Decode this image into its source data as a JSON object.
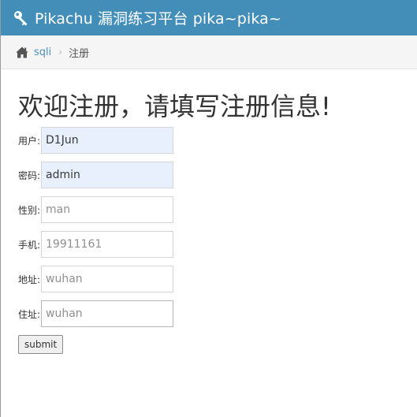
{
  "header": {
    "title": "Pikachu 漏洞练习平台 pika~pika~",
    "icon": "key-icon"
  },
  "breadcrumb": {
    "home_icon": "home-icon",
    "link": "sqli",
    "separator": "›",
    "current": "注册"
  },
  "page": {
    "heading": "欢迎注册，请填写注册信息!"
  },
  "form": {
    "fields": [
      {
        "label": "用户:",
        "value": "D1Jun",
        "placeholder": ""
      },
      {
        "label": "密码:",
        "value": "admin",
        "placeholder": ""
      },
      {
        "label": "性别:",
        "value": "",
        "placeholder": "man"
      },
      {
        "label": "手机:",
        "value": "",
        "placeholder": "19911161"
      },
      {
        "label": "地址:",
        "value": "",
        "placeholder": "wuhan"
      },
      {
        "label": "住址:",
        "value": "",
        "placeholder": "wuhan"
      }
    ],
    "submit_label": "submit"
  },
  "colors": {
    "navbar": "#438eb9",
    "link": "#4c8fbd",
    "autofill": "#e8f0fe"
  }
}
